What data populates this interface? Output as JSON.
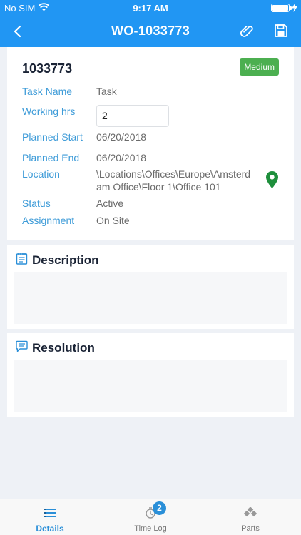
{
  "status_bar": {
    "carrier": "No SIM",
    "time": "9:17 AM"
  },
  "nav": {
    "title": "WO-1033773",
    "icons": [
      "back-icon",
      "paperclip-icon",
      "save-icon"
    ]
  },
  "details": {
    "wo_number": "1033773",
    "priority": "Medium",
    "priority_color": "#4caf50",
    "task_name_label": "Task Name",
    "task_name_value": "Task",
    "working_hrs_label": "Working hrs",
    "working_hrs_value": "2",
    "planned_start_label": "Planned Start",
    "planned_start_value": "06/20/2018",
    "planned_end_label": "Planned End",
    "planned_end_value": "06/20/2018",
    "location_label": "Location",
    "location_line1": "\\Locations\\Offices\\Europe\\Amsterd",
    "location_line2": "am Office\\Floor 1\\Office 101",
    "status_label": "Status",
    "status_value": "Active",
    "assignment_label": "Assignment",
    "assignment_value": "On Site"
  },
  "description": {
    "title": "Description"
  },
  "resolution": {
    "title": "Resolution"
  },
  "tabs": [
    {
      "label": "Details",
      "active": true,
      "icon": "list-icon"
    },
    {
      "label": "Time Log",
      "badge": "2",
      "icon": "timer-icon"
    },
    {
      "label": "Parts",
      "icon": "parts-icon"
    }
  ],
  "colors": {
    "primary": "#2196f3",
    "label_blue": "#3d9bd8",
    "accent": "#4caf50",
    "background": "#eef1f6"
  }
}
